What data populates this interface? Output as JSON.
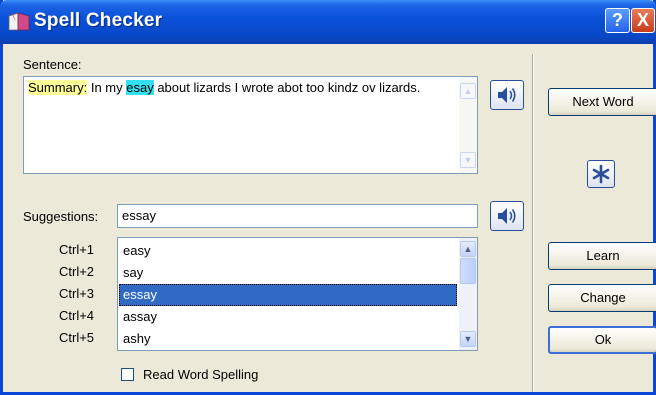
{
  "window": {
    "title": "Spell Checker",
    "help_glyph": "?",
    "close_glyph": "X"
  },
  "sentence": {
    "label": "Sentence:",
    "prefix": "Summary:",
    "between": " In my ",
    "misspelled": "esay",
    "rest": " about lizards I wrote abot too kindz ov lizards."
  },
  "suggestions": {
    "label": "Suggestions:",
    "input_value": "essay",
    "items": [
      {
        "shortcut": "Ctrl+1",
        "word": "easy"
      },
      {
        "shortcut": "Ctrl+2",
        "word": "say"
      },
      {
        "shortcut": "Ctrl+3",
        "word": "essay"
      },
      {
        "shortcut": "Ctrl+4",
        "word": "assay"
      },
      {
        "shortcut": "Ctrl+5",
        "word": "ashy"
      }
    ],
    "selected_index": 2
  },
  "read_spelling": {
    "label": "Read Word Spelling",
    "checked": false
  },
  "buttons": {
    "next_word": "Next Word",
    "learn": "Learn",
    "change": "Change",
    "ok": "Ok"
  },
  "colors": {
    "title_bar": "#0a52d8",
    "highlight_prefix": "#ffff99",
    "highlight_word": "#33e0f0",
    "selection": "#316ac5"
  },
  "icons": {
    "speaker": "speaker-icon",
    "star": "asterisk-icon",
    "app": "book-icon"
  }
}
